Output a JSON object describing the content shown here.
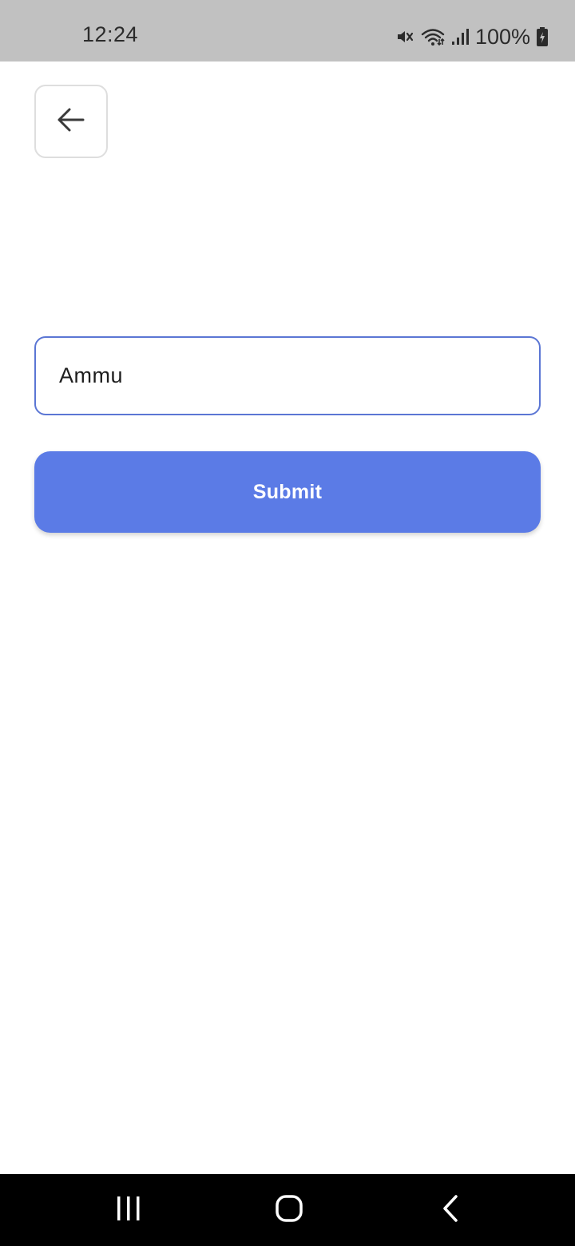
{
  "status_bar": {
    "time": "12:24",
    "battery": "100%",
    "icons": [
      "mute-icon",
      "wifi-icon",
      "signal-icon",
      "battery-icon"
    ]
  },
  "header": {
    "back_icon": "arrow-left-icon"
  },
  "form": {
    "name_value": "Ammu",
    "submit_label": "Submit"
  },
  "nav_bar": {
    "icons": [
      "recents-icon",
      "home-icon",
      "back-chevron-icon"
    ]
  },
  "colors": {
    "accent": "#5b7be6",
    "input_border": "#5b76d4",
    "status_bar": "#c1c1c1",
    "nav_bar": "#000000"
  }
}
